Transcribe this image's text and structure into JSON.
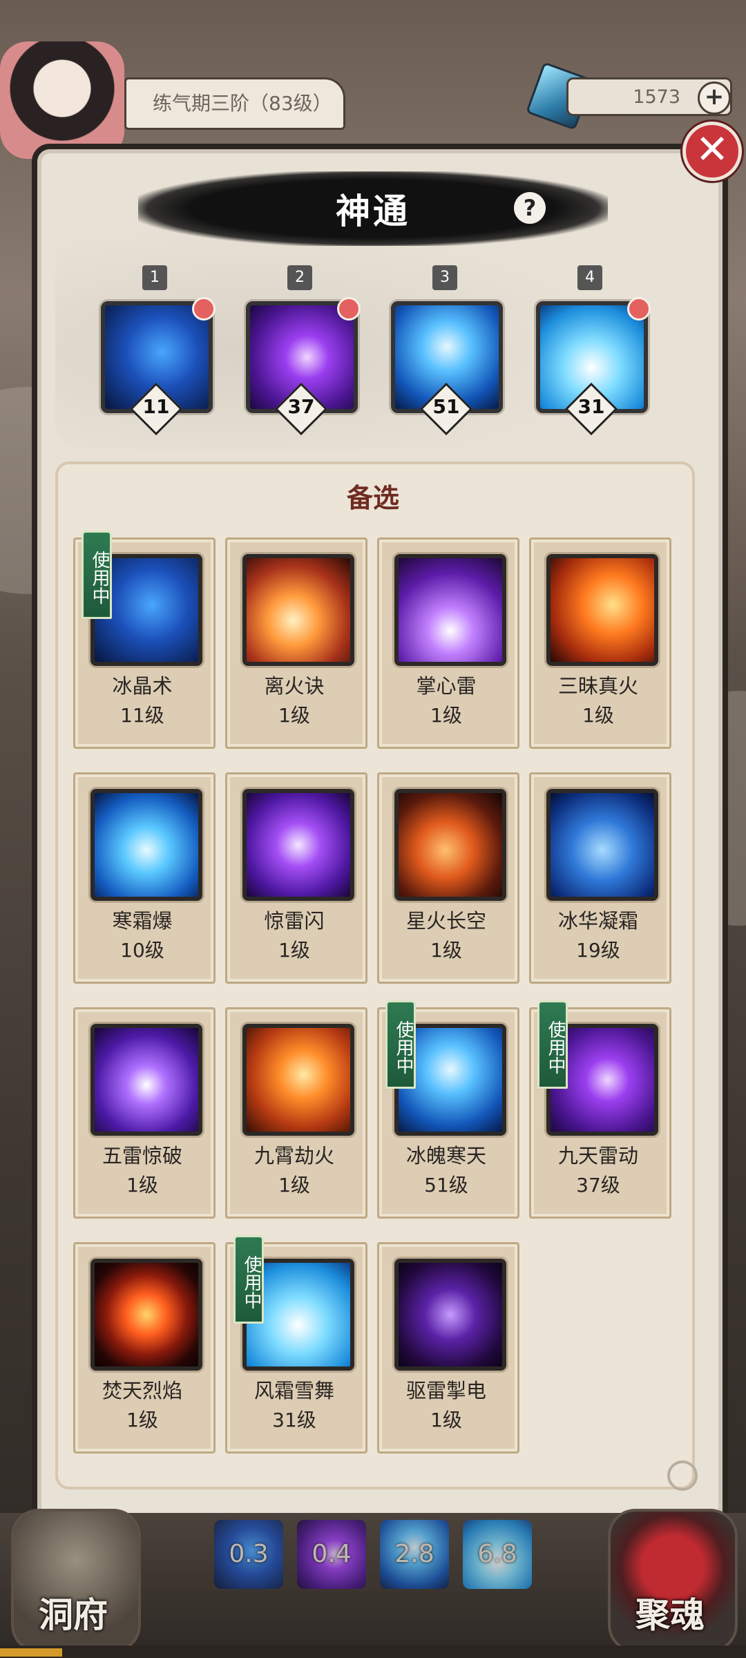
{
  "header": {
    "rank": "练气期三阶（83级）",
    "currency": "1573",
    "plus_label": "+"
  },
  "panel": {
    "title": "神通",
    "help_label": "?",
    "close_label": "✕"
  },
  "equipped_slots": [
    {
      "number": "1",
      "level": "11",
      "icon": "ice-crystal-skill-icon",
      "has_notification": true
    },
    {
      "number": "2",
      "level": "37",
      "icon": "purple-lightning-skill-icon",
      "has_notification": true
    },
    {
      "number": "3",
      "level": "51",
      "icon": "snowflake-skill-icon",
      "has_notification": false
    },
    {
      "number": "4",
      "level": "31",
      "icon": "ice-wave-skill-icon",
      "has_notification": true
    }
  ],
  "alternates": {
    "title": "备选",
    "in_use_label": "使用中",
    "skills": [
      {
        "name": "冰晶术",
        "level": "11级",
        "icon": "ice-crystal-skill-icon",
        "in_use": true
      },
      {
        "name": "离火诀",
        "level": "1级",
        "icon": "fireball-skill-icon",
        "in_use": false
      },
      {
        "name": "掌心雷",
        "level": "1级",
        "icon": "palm-lightning-skill-icon",
        "in_use": false
      },
      {
        "name": "三昧真火",
        "level": "1级",
        "icon": "true-fire-skill-icon",
        "in_use": false
      },
      {
        "name": "寒霜爆",
        "level": "10级",
        "icon": "frost-burst-skill-icon",
        "in_use": false
      },
      {
        "name": "惊雷闪",
        "level": "1级",
        "icon": "thunder-flash-skill-icon",
        "in_use": false
      },
      {
        "name": "星火长空",
        "level": "1级",
        "icon": "meteor-fire-skill-icon",
        "in_use": false
      },
      {
        "name": "冰华凝霜",
        "level": "19级",
        "icon": "ice-bloom-skill-icon",
        "in_use": false
      },
      {
        "name": "五雷惊破",
        "level": "1级",
        "icon": "five-thunder-skill-icon",
        "in_use": false
      },
      {
        "name": "九霄劫火",
        "level": "1级",
        "icon": "tribulation-fire-skill-icon",
        "in_use": false
      },
      {
        "name": "冰魄寒天",
        "level": "51级",
        "icon": "snowflake-skill-icon",
        "in_use": true
      },
      {
        "name": "九天雷动",
        "level": "37级",
        "icon": "purple-lightning-skill-icon",
        "in_use": true
      },
      {
        "name": "焚天烈焰",
        "level": "1级",
        "icon": "fire-vortex-skill-icon",
        "in_use": false
      },
      {
        "name": "风霜雪舞",
        "level": "31级",
        "icon": "ice-wave-skill-icon",
        "in_use": true
      },
      {
        "name": "驱雷掣电",
        "level": "1级",
        "icon": "dark-lightning-skill-icon",
        "in_use": false
      }
    ]
  },
  "bottom_bar": {
    "left_button": "洞府",
    "right_button": "聚魂",
    "cooldowns": [
      "0.3",
      "0.4",
      "2.8",
      "6.8"
    ]
  },
  "colors": {
    "ice": "#1f6fd6",
    "lightning": "#7b32d8",
    "fire": "#e8652a",
    "in_use_tag": "#2f7a52",
    "close": "#c9353b"
  }
}
